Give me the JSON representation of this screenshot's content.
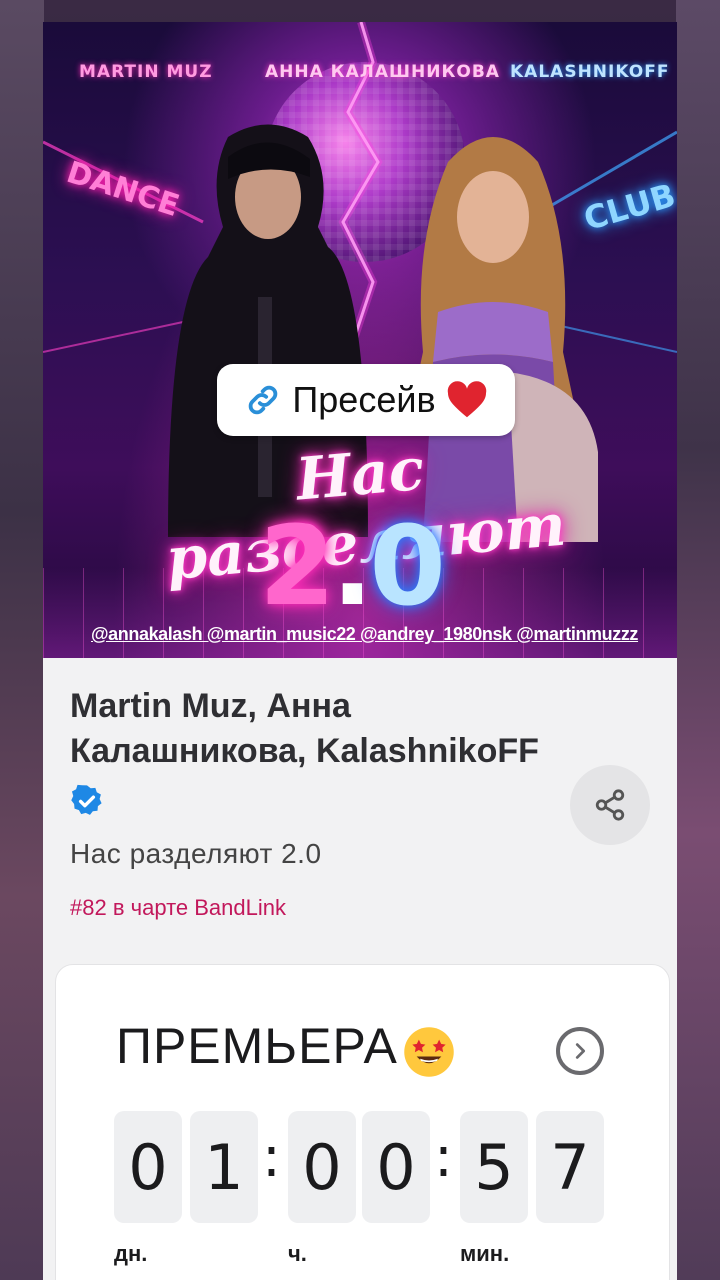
{
  "cover": {
    "artist_tags": [
      "MARTIN MUZ",
      "АННА КАЛАШНИКОВА",
      "KALASHNIKOFF"
    ],
    "neon_left": "DANCE",
    "neon_right": "CLUB",
    "title": "Нас разделяют",
    "version_a": "2",
    "version_dot": ".",
    "version_b": "0",
    "handles": "@annakalash @martin_music22 @andrey_1980nsk @martinmuzzz"
  },
  "presave": {
    "label": "Пресейв",
    "icon": "link-icon",
    "emoji": "red-heart"
  },
  "release": {
    "artists": "Martin Muz, Анна Калашникова, KalashnikoFF",
    "track": "Нас разделяют 2.0",
    "chart": "#82 в чарте BandLink",
    "verified_icon": "verified-check-icon",
    "share_icon": "share-icon"
  },
  "premiere": {
    "title": "ПРЕМЬЕРА",
    "emoji": "star-struck",
    "digits": [
      "0",
      "1",
      "0",
      "0",
      "5",
      "7"
    ],
    "separator": ":",
    "units": [
      "дн.",
      "ч.",
      "мин."
    ]
  },
  "colors": {
    "accent": "#c2185b",
    "verified": "#1e88e5",
    "card_bg": "#f2f2f3"
  }
}
